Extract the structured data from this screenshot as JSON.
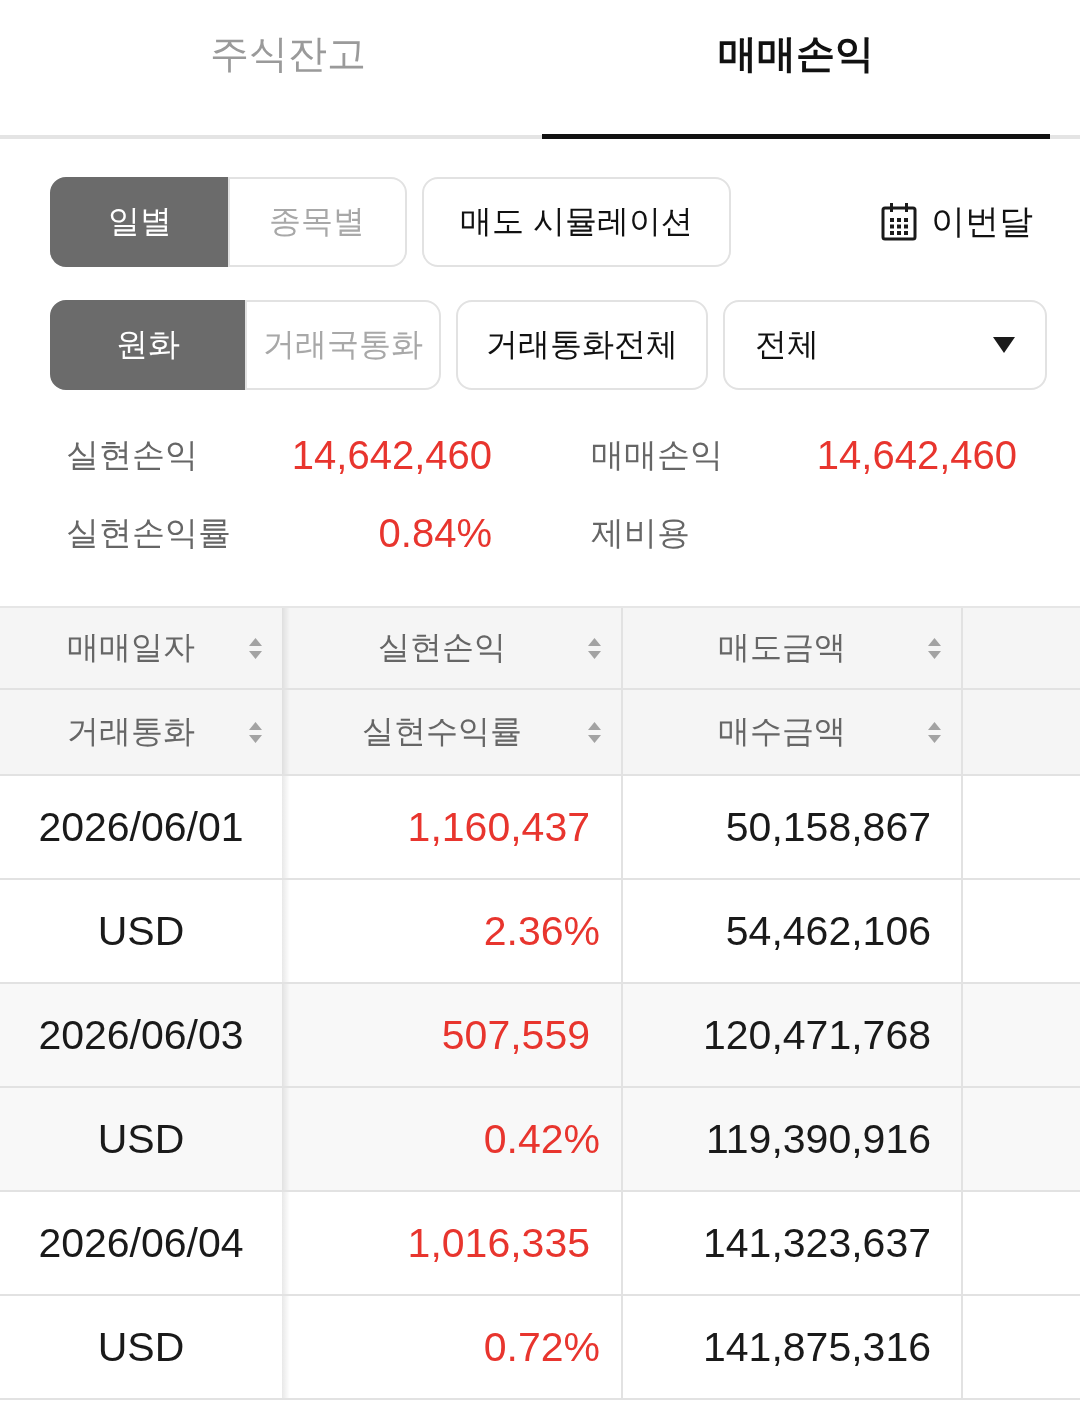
{
  "tabs": [
    {
      "label": "주식잔고",
      "selected": false
    },
    {
      "label": "매매손익",
      "selected": true
    }
  ],
  "view_toggle": [
    {
      "label": "일별",
      "selected": true
    },
    {
      "label": "종목별",
      "selected": false
    }
  ],
  "simulation_button": {
    "label": "매도 시뮬레이션"
  },
  "period_button": {
    "label": "이번달"
  },
  "currency_toggle": [
    {
      "label": "원화",
      "selected": true
    },
    {
      "label": "거래국통화",
      "selected": false
    }
  ],
  "currency_filter_button": {
    "label": "거래통화전체"
  },
  "market_select": {
    "value": "전체"
  },
  "summary": [
    {
      "label": "실현손익",
      "value": "14,642,460"
    },
    {
      "label": "매매손익",
      "value": "14,642,460"
    },
    {
      "label": "실현손익률",
      "value": "0.84%"
    },
    {
      "label": "제비용"
    }
  ],
  "table": {
    "header_rows": [
      [
        "매매일자",
        "실현손익",
        "매도금액"
      ],
      [
        "거래통화",
        "실현수익률",
        "매수금액"
      ]
    ],
    "records": [
      {
        "date": "2026/06/01",
        "currency": "USD",
        "realized_pnl": "1,160,437",
        "realized_return": "2.36%",
        "sell_amount": "50,158,867",
        "buy_amount": "54,462,106"
      },
      {
        "date": "2026/06/03",
        "currency": "USD",
        "realized_pnl": "507,559",
        "realized_return": "0.42%",
        "sell_amount": "120,471,768",
        "buy_amount": "119,390,916"
      },
      {
        "date": "2026/06/04",
        "currency": "USD",
        "realized_pnl": "1,016,335",
        "realized_return": "0.72%",
        "sell_amount": "141,323,637",
        "buy_amount": "141,875,316"
      }
    ]
  }
}
